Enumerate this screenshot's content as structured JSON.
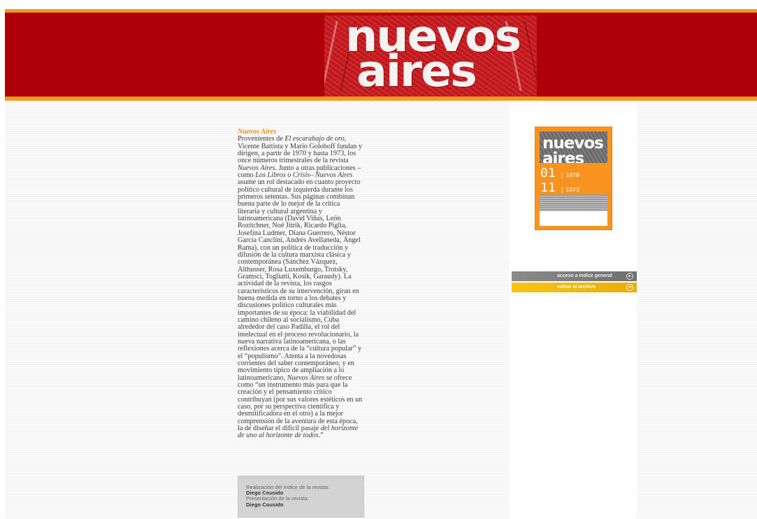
{
  "header": {
    "logo_line1": "nuevos",
    "logo_line2": "aires"
  },
  "intro": {
    "title": "Nuevos Aires",
    "paragraph_html": "Provenientes de <em>El escarabajo de oro</em>, Vicente Battista y Mario Goloboff fundan y dirigen, a partir de 1970 y hasta 1973, los once números trimestrales de la revista <em>Nuevos Aires</em>. Junto a otras publicaciones –como <em>Los Libros</em> o <em>Crisis</em>– <em>Nuevos Aires</em> asume un rol destacado en cuanto proyecto político cultural de izquierda durante los primeros setentas. Sus páginas combinan buena parte de lo mejor de la crítica literaria y cultural argentina y latinoamericana (David Viñas, León Rozitchner, Noé Jitrik, Ricardo Piglia, Josefina Ludmer, Diana Guerrero, Néstor García Canclini, Andrés Avellaneda, Ángel Rama), con un política de traducción y difusión de la cultura marxista clásica y contemporánea (Sánchez Vázquez, Althusser, Rosa Luxemburgo, Trotsky, Gramsci, Togliatti, Kosik, Garaudy). La actividad de la revista, los rasgos característicos de su intervención, giran en buena medida en torno a los debates y discusiones político culturales más importantes de su época: la viabilidad del camino chileno al socialismo, Cuba alrededor del caso Padilla, el rol del intelectual en el proceso revolucionario, la nueva narrativa latinoamericana, o las reflexiones acerca de la “cultura popular” y el “populismo”. Atenta a la novedosas corrientes del saber contemporáneo, y en movimiento típico de ampliación a lo latinoamericano, <em>Nuevos Aires</em> se ofrece como “un instrumento más para que la creación y el pensamiento crítico contribuyan (por sus valores estéticos en un caso, por su perspectiva científica y desmitificadora en el otro) a la mejor comprensión de la aventura de esta época, la de diseñar el difícil pasaje <em>del horizonte de uno al horizonte de todos</em>.”"
  },
  "credits": {
    "line1": "Realización del índice de la revista:",
    "name1": "Diego Cousido",
    "line2": "Presentación de la revista:",
    "name2": "Diego Cousido"
  },
  "cover": {
    "logo": "nuevos aires",
    "first_issue": "01",
    "first_year": "1970",
    "last_issue": "11",
    "last_year": "1973",
    "separator": "|"
  },
  "nav": {
    "index_label": "acceso a índice general",
    "archive_label": "volver al archivo"
  },
  "colors": {
    "header_red": "#ab0008",
    "accent_orange": "#f39a1d",
    "button_gold": "#f7c515",
    "button_gray": "#7a7a7a"
  }
}
